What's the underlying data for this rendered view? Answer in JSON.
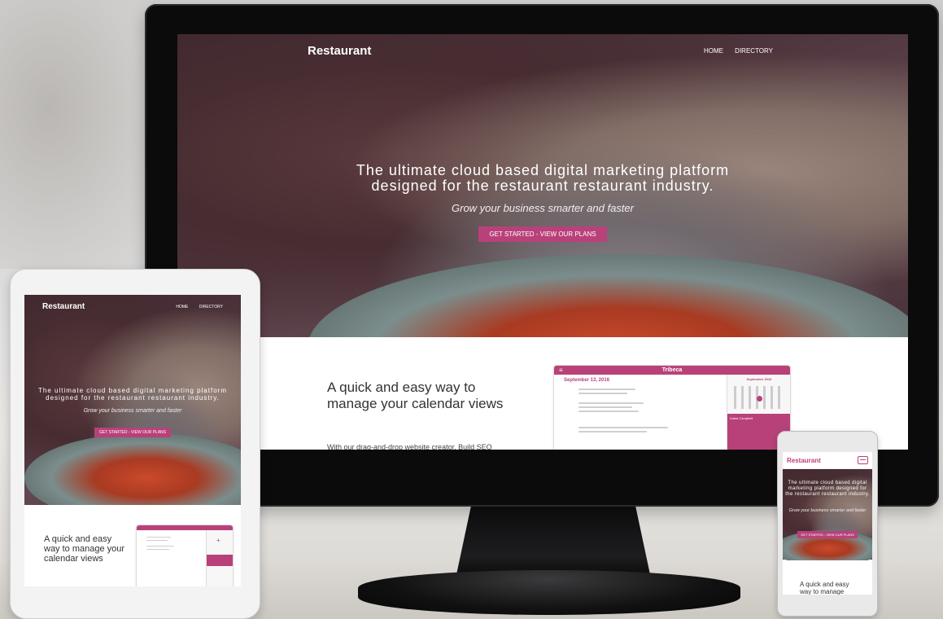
{
  "site": {
    "brand": "Restaurant",
    "nav_links": [
      "HOME",
      "DIRECTORY"
    ],
    "headline_line1": "The ultimate cloud based digital marketing platform",
    "headline_line2": "designed for the restaurant restaurant industry.",
    "tagline": "Grow your business smarter and faster",
    "cta_label": "GET STARTED - VIEW OUR PLANS",
    "section_title": "A quick and easy way to manage your calendar views",
    "section_body": "With our drag-and-drop website creator. Build SEO"
  },
  "calendar_preview": {
    "location": "Tribeca",
    "date_heading": "September 13, 2016",
    "mini_month": "September 2016",
    "selected_name": "Kaela Campbell"
  },
  "colors": {
    "accent": "#b9417a",
    "bezel": "#0b0b0c"
  }
}
